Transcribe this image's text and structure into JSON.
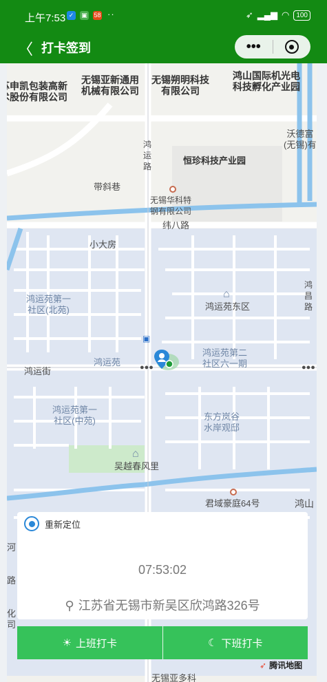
{
  "status_bar": {
    "time": "上午7:53",
    "notification_badge": "58",
    "more": "··",
    "battery": "100"
  },
  "nav": {
    "back": "〈",
    "title": "打卡签到",
    "more": "•••"
  },
  "map": {
    "labels": [
      {
        "id": "kaibao",
        "text": "苏申凯包装高新\n术股份有限公司"
      },
      {
        "id": "yaxin",
        "text": "无锡亚新通用\n机械有限公司"
      },
      {
        "id": "shuoming",
        "text": "无锡朔明科技\n有限公司"
      },
      {
        "id": "hongshan",
        "text": "鸿山国际机光电\n科技孵化产业园"
      },
      {
        "id": "wode",
        "text": "沃德富\n(无锡)有"
      },
      {
        "id": "hongyun-road-v",
        "text": "鸿\n运\n路"
      },
      {
        "id": "hengzhen",
        "text": "恒珍科技产业园"
      },
      {
        "id": "daixiexiang",
        "text": "带斜巷"
      },
      {
        "id": "huakete",
        "text": "无锡华科特\n钢有限公司"
      },
      {
        "id": "weibalu",
        "text": "纬八路"
      },
      {
        "id": "xiaodafang",
        "text": "小大房"
      },
      {
        "id": "hongchanglu",
        "text": "鸿\n昌\n路"
      },
      {
        "id": "beiyuan",
        "text": "鸿运苑第一\n社区(北苑)"
      },
      {
        "id": "dongqu",
        "text": "鸿运苑东区"
      },
      {
        "id": "liuyiqi",
        "text": "鸿运苑第二\n社区六一期"
      },
      {
        "id": "hongyunjie",
        "text": "鸿运街"
      },
      {
        "id": "hongyunyuan",
        "text": "鸿运苑"
      },
      {
        "id": "zhongyuan",
        "text": "鸿运苑第一\n社区(中苑)"
      },
      {
        "id": "lanyu",
        "text": "东方岚谷\n水岸观邸"
      },
      {
        "id": "wuyue",
        "text": "吴越春风里"
      },
      {
        "id": "junyu",
        "text": "君域豪庭64号"
      },
      {
        "id": "hongshan2",
        "text": "鸿山"
      },
      {
        "id": "he",
        "text": "河"
      },
      {
        "id": "lu",
        "text": "路"
      },
      {
        "id": "hua",
        "text": "化\n司"
      },
      {
        "id": "bottom",
        "text": "无锡亚多科"
      }
    ]
  },
  "panel": {
    "relocate_label": "重新定位",
    "time": "07:53:02",
    "address": "江苏省无锡市新吴区欣鸿路326号"
  },
  "buttons": {
    "clock_in": "上班打卡",
    "clock_out": "下班打卡"
  },
  "brand": {
    "name": "腾讯地图"
  },
  "colors": {
    "nav_bg": "#138a13",
    "button_bg": "#36c25a",
    "accent_blue": "#2a88d8",
    "water": "#8cc3ec"
  }
}
